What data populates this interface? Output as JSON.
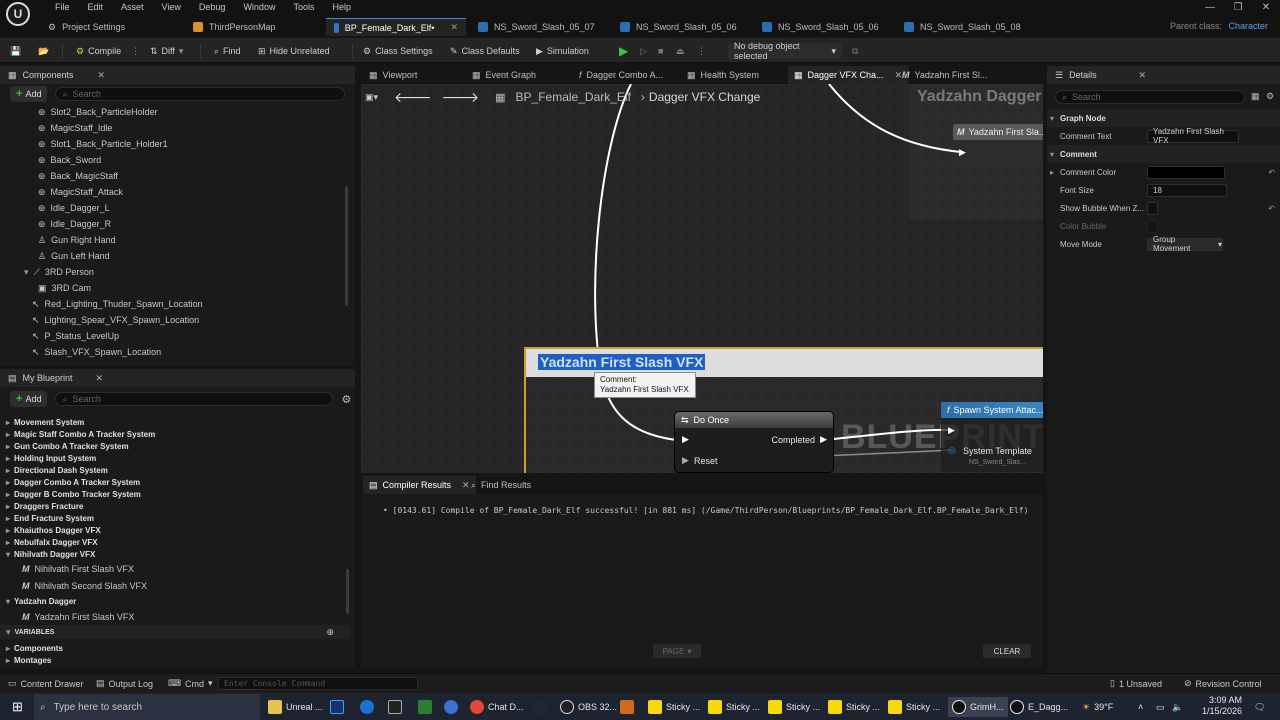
{
  "menu": {
    "items": [
      "File",
      "Edit",
      "Asset",
      "View",
      "Debug",
      "Window",
      "Tools",
      "Help"
    ]
  },
  "logo": {
    "glyph": "U"
  },
  "doc_tabs": [
    {
      "label": "Project Settings",
      "icon": "gear-icon"
    },
    {
      "label": "ThirdPersonMap",
      "icon": "map-icon"
    },
    {
      "label": "BP_Female_Dark_Elf•",
      "icon": "blueprint-icon",
      "active": true
    },
    {
      "label": "NS_Sword_Slash_05_07",
      "icon": "niagara-icon"
    },
    {
      "label": "NS_Sword_Slash_05_06",
      "icon": "niagara-icon"
    },
    {
      "label": "NS_Sword_Slash_05_06",
      "icon": "niagara-icon"
    },
    {
      "label": "NS_Sword_Slash_05_08",
      "icon": "niagara-icon"
    }
  ],
  "parent_class": {
    "label": "Parent class:",
    "value": "Character"
  },
  "toolbar": {
    "compile": "Compile",
    "diff": "Diff",
    "find": "Find",
    "hide_unrelated": "Hide Unrelated",
    "class_settings": "Class Settings",
    "class_defaults": "Class Defaults",
    "simulation": "Simulation",
    "debug_object": "No debug object selected"
  },
  "components": {
    "title": "Components",
    "add": "Add",
    "search_placeholder": "Search",
    "items": [
      "Slot2_Back_ParticleHolder",
      "MagicStaff_Idle",
      "Slot1_Back_Particle_Holder1",
      "Back_Sword",
      "Back_MagicStaff",
      "MagicStaff_Attack",
      "Idle_Dagger_L",
      "Idle_Dagger_R",
      "Gun Right Hand",
      "Gun Left Hand",
      "3RD Person",
      "3RD Cam",
      "Red_Lighting_Thuder_Spawn_Location",
      "Lighting_Spear_VFX_Spawn_Location",
      "P_Status_LevelUp",
      "Slash_VFX_Spawn_Location"
    ]
  },
  "my_blueprint": {
    "title": "My Blueprint",
    "add": "Add",
    "search_placeholder": "Search",
    "graphs": [
      "Movement System",
      "Magic Staff Combo A Tracker System",
      "Gun Combo A Tracker System",
      "Holding Input System",
      "Directional Dash System",
      "Dagger Combo A Tracker System",
      "Dagger B Combo Tracker System",
      "Draggers Fracture",
      "End Fracture System",
      "Khaiuthos Dagger VFX",
      "Nebulfalx Dagger VFX",
      "Nihilvath Dagger VFX"
    ],
    "nihilvath_children": [
      "Nihilvath First Slash VFX",
      "Nihilvath Second Slash VFX"
    ],
    "yadzahn": "Yadzahn Dagger",
    "yadzahn_children": [
      "Yadzahn First Slash VFX"
    ],
    "variables_header": "VARIABLES",
    "variables": [
      "Components",
      "Montages"
    ]
  },
  "graph_tabs": [
    {
      "label": "Viewport",
      "icon": "viewport-icon"
    },
    {
      "label": "Event Graph",
      "icon": "graph-icon"
    },
    {
      "label": "Dagger Combo A...",
      "icon": "function-icon"
    },
    {
      "label": "Health System",
      "icon": "graph-icon"
    },
    {
      "label": "Dagger VFX Cha...",
      "icon": "graph-icon",
      "active": true
    },
    {
      "label": "Yadzahn First Sl...",
      "icon": "macro-icon"
    }
  ],
  "breadcrumb": {
    "root": "BP_Female_Dark_Elf",
    "current": "Dagger VFX Change"
  },
  "graph": {
    "top_comment": "Yadzahn Dagger",
    "top_node": "Yadzahn First Sla...",
    "comment_title": "Yadzahn First Slash VFX",
    "tooltip_label": "Comment:",
    "tooltip_value": "Yadzahn First Slash VFX",
    "do_once": "Do Once",
    "completed": "Completed",
    "reset": "Reset",
    "spawn_node": "Spawn System Attac...",
    "system_template": "System Template",
    "template_value": "NS_Sword_Slas...",
    "watermark": "BLUEPRINT"
  },
  "bottom_tabs": {
    "compiler": "Compiler Results",
    "find": "Find Results"
  },
  "compiler": {
    "message": "[0143.61] Compile of BP_Female_Dark_Elf successful! [in 881 ms] (/Game/ThirdPerson/Blueprints/BP_Female_Dark_Elf.BP_Female_Dark_Elf)",
    "page": "PAGE",
    "clear": "CLEAR"
  },
  "details": {
    "title": "Details",
    "search_placeholder": "Search",
    "graph_node_section": "Graph Node",
    "comment_text_label": "Comment Text",
    "comment_text_value": "Yadzahn First Slash VFX",
    "comment_section": "Comment",
    "comment_color_label": "Comment Color",
    "comment_color_value": "#000000",
    "font_size_label": "Font Size",
    "font_size_value": "18",
    "show_bubble_label": "Show Bubble When Z...",
    "color_bubble_label": "Color Bubble",
    "move_mode_label": "Move Mode",
    "move_mode_value": "Group Movement"
  },
  "statusbar": {
    "content_drawer": "Content Drawer",
    "output_log": "Output Log",
    "cmd": "Cmd",
    "console_placeholder": "Enter Console Command",
    "unsaved": "1 Unsaved",
    "revision": "Revision Control"
  },
  "taskbar": {
    "search_placeholder": "Type here to search",
    "apps": [
      "Unreal ...",
      "Chat D...",
      "OBS 32...",
      "Sticky ...",
      "Sticky ...",
      "Sticky ...",
      "Sticky ...",
      "Sticky ...",
      "GrimH...",
      "E_Dagg..."
    ],
    "weather": "39°F",
    "time": "3:09 AM",
    "date": "1/15/2026"
  }
}
